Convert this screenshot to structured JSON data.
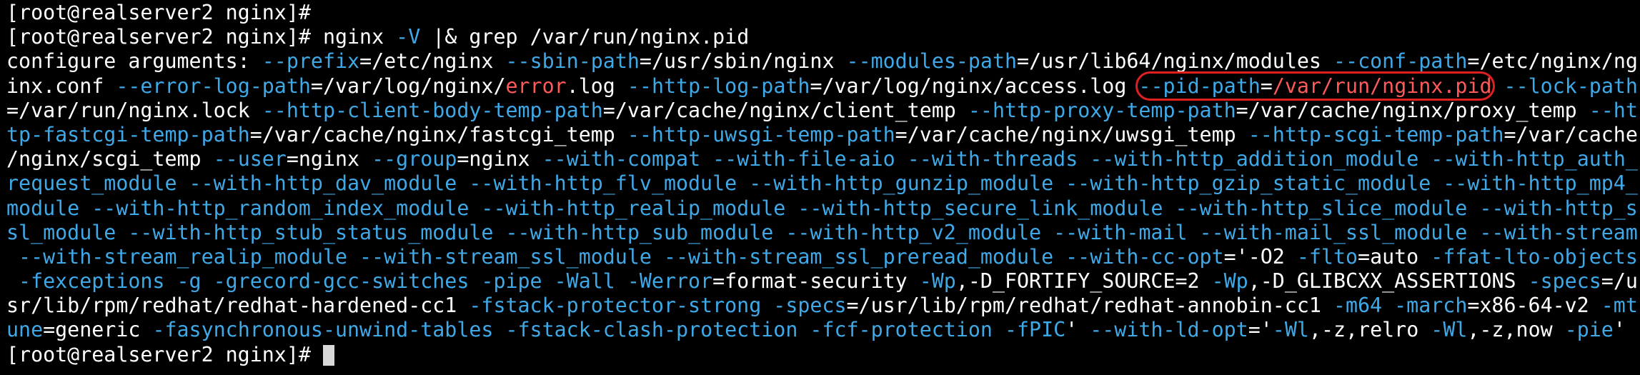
{
  "terminal": {
    "lines": [
      [
        {
          "t": "[root@realserver2 nginx]# ",
          "c": "w"
        }
      ],
      [
        {
          "t": "[root@realserver2 nginx]# nginx ",
          "c": "w"
        },
        {
          "t": "-V",
          "c": "o"
        },
        {
          "t": " |& grep /var/run/nginx.pid",
          "c": "w"
        }
      ],
      [
        {
          "t": "configure arguments: ",
          "c": "w"
        },
        {
          "t": "--prefix",
          "c": "o"
        },
        {
          "t": "=/etc/nginx ",
          "c": "w"
        },
        {
          "t": "--sbin-path",
          "c": "o"
        },
        {
          "t": "=/usr/sbin/nginx ",
          "c": "w"
        },
        {
          "t": "--modules-path",
          "c": "o"
        },
        {
          "t": "=/usr/lib64/nginx/modules ",
          "c": "w"
        },
        {
          "t": "--conf-path",
          "c": "o"
        },
        {
          "t": "=/etc/nginx/ng",
          "c": "w"
        }
      ],
      [
        {
          "t": "inx.conf ",
          "c": "w"
        },
        {
          "t": "--error-log-path",
          "c": "o"
        },
        {
          "t": "=/var/log/nginx/",
          "c": "w"
        },
        {
          "t": "error",
          "c": "r"
        },
        {
          "t": ".log ",
          "c": "w"
        },
        {
          "t": "--http-log-path",
          "c": "o"
        },
        {
          "t": "=/var/log/nginx/access.log ",
          "c": "w"
        },
        {
          "t": "--pid-path",
          "c": "o",
          "hl": "start"
        },
        {
          "t": "=",
          "c": "w",
          "hl": "mid"
        },
        {
          "t": "/var/run/nginx.pid",
          "c": "r",
          "hl": "end"
        },
        {
          "t": " ",
          "c": "w"
        },
        {
          "t": "--lock-path",
          "c": "o"
        }
      ],
      [
        {
          "t": "=/var/run/nginx.lock ",
          "c": "w"
        },
        {
          "t": "--http-client-body-temp-path",
          "c": "o"
        },
        {
          "t": "=/var/cache/nginx/client_temp ",
          "c": "w"
        },
        {
          "t": "--http-proxy-temp-path",
          "c": "o"
        },
        {
          "t": "=/var/cache/nginx/proxy_temp ",
          "c": "w"
        },
        {
          "t": "--ht",
          "c": "o"
        }
      ],
      [
        {
          "t": "tp-fastcgi-temp-path",
          "c": "o"
        },
        {
          "t": "=/var/cache/nginx/fastcgi_temp ",
          "c": "w"
        },
        {
          "t": "--http-uwsgi-temp-path",
          "c": "o"
        },
        {
          "t": "=/var/cache/nginx/uwsgi_temp ",
          "c": "w"
        },
        {
          "t": "--http-scgi-temp-path",
          "c": "o"
        },
        {
          "t": "=/var/cache",
          "c": "w"
        }
      ],
      [
        {
          "t": "/nginx/scgi_temp ",
          "c": "w"
        },
        {
          "t": "--user",
          "c": "o"
        },
        {
          "t": "=nginx ",
          "c": "w"
        },
        {
          "t": "--group",
          "c": "o"
        },
        {
          "t": "=nginx ",
          "c": "w"
        },
        {
          "t": "--with-compat --with-file-aio --with-threads --with-http_addition_module --with-http_auth_",
          "c": "o"
        }
      ],
      [
        {
          "t": "request_module --with-http_dav_module --with-http_flv_module --with-http_gunzip_module --with-http_gzip_static_module --with-http_mp4_",
          "c": "o"
        }
      ],
      [
        {
          "t": "module --with-http_random_index_module --with-http_realip_module --with-http_secure_link_module --with-http_slice_module --with-http_s",
          "c": "o"
        }
      ],
      [
        {
          "t": "sl_module --with-http_stub_status_module --with-http_sub_module --with-http_v2_module --with-mail --with-mail_ssl_module --with-stream",
          "c": "o"
        }
      ],
      [
        {
          "t": " --with-stream_realip_module --with-stream_ssl_module --with-stream_ssl_preread_module --with-cc-opt",
          "c": "o"
        },
        {
          "t": "='-O2 ",
          "c": "w"
        },
        {
          "t": "-flto",
          "c": "o"
        },
        {
          "t": "=auto ",
          "c": "w"
        },
        {
          "t": "-ffat-lto-objects",
          "c": "o"
        }
      ],
      [
        {
          "t": " -fexceptions -g -grecord-gcc-switches -pipe -Wall -Werror",
          "c": "o"
        },
        {
          "t": "=format-security ",
          "c": "w"
        },
        {
          "t": "-Wp",
          "c": "o"
        },
        {
          "t": ",-D_FORTIFY_SOURCE=2 ",
          "c": "w"
        },
        {
          "t": "-Wp",
          "c": "o"
        },
        {
          "t": ",-D_GLIBCXX_ASSERTIONS ",
          "c": "w"
        },
        {
          "t": "-specs",
          "c": "o"
        },
        {
          "t": "=/u",
          "c": "w"
        }
      ],
      [
        {
          "t": "sr/lib/rpm/redhat/redhat-hardened-cc1 ",
          "c": "w"
        },
        {
          "t": "-fstack-protector-strong -specs",
          "c": "o"
        },
        {
          "t": "=/usr/lib/rpm/redhat/redhat-annobin-cc1 ",
          "c": "w"
        },
        {
          "t": "-m64 -march",
          "c": "o"
        },
        {
          "t": "=x86-64-v2 ",
          "c": "w"
        },
        {
          "t": "-mt",
          "c": "o"
        }
      ],
      [
        {
          "t": "une",
          "c": "o"
        },
        {
          "t": "=generic ",
          "c": "w"
        },
        {
          "t": "-fasynchronous-unwind-tables -fstack-clash-protection -fcf-protection -fPIC",
          "c": "o"
        },
        {
          "t": "' ",
          "c": "w"
        },
        {
          "t": "--with-ld-opt",
          "c": "o"
        },
        {
          "t": "='",
          "c": "w"
        },
        {
          "t": "-Wl",
          "c": "o"
        },
        {
          "t": ",-z,relro ",
          "c": "w"
        },
        {
          "t": "-Wl",
          "c": "o"
        },
        {
          "t": ",-z,now ",
          "c": "w"
        },
        {
          "t": "-pie",
          "c": "o"
        },
        {
          "t": "'",
          "c": "w"
        }
      ],
      [
        {
          "t": "[root@realserver2 nginx]# ",
          "c": "w"
        }
      ]
    ],
    "cursor_line": 14
  }
}
